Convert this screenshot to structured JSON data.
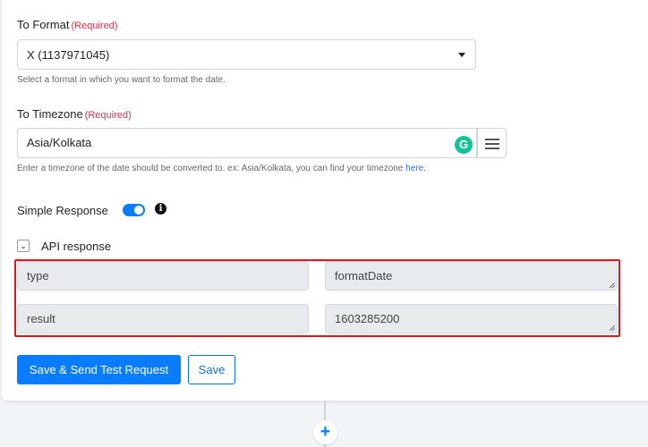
{
  "to_format": {
    "label": "To Format",
    "required": "(Required)",
    "selected": "X (1137971045)",
    "help": "Select a format in which you want to format the date."
  },
  "to_timezone": {
    "label": "To Timezone",
    "required": "(Required)",
    "value": "Asia/Kolkata",
    "help_prefix": "Enter a timezone of the date should be converted to. ex: Asia/Kolkata, you can find your timezone ",
    "help_link": "here",
    "help_suffix": ".",
    "grammarly_glyph": "G"
  },
  "simple_response": {
    "label": "Simple Response",
    "enabled": true,
    "info_glyph": "i"
  },
  "api_response": {
    "label": "API response",
    "expanded": true,
    "rows": [
      {
        "key": "type",
        "value": "formatDate"
      },
      {
        "key": "result",
        "value": "1603285200"
      }
    ]
  },
  "actions": {
    "primary": "Save & Send Test Request",
    "secondary": "Save"
  },
  "add_step_glyph": "+",
  "colors": {
    "accent": "#0a7cff",
    "required": "#d0334a",
    "highlight": "#e0161c"
  }
}
